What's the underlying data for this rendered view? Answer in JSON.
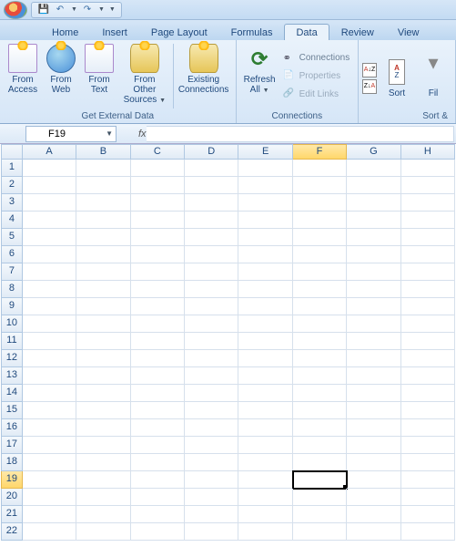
{
  "qat": {
    "save": "💾",
    "undo": "↶",
    "redo": "↷"
  },
  "tabs": [
    "Home",
    "Insert",
    "Page Layout",
    "Formulas",
    "Data",
    "Review",
    "View"
  ],
  "activeTab": 4,
  "ribbon": {
    "group1": {
      "label": "Get External Data",
      "btns": [
        {
          "l1": "From",
          "l2": "Access"
        },
        {
          "l1": "From",
          "l2": "Web"
        },
        {
          "l1": "From",
          "l2": "Text"
        },
        {
          "l1": "From Other",
          "l2": "Sources",
          "dd": true
        }
      ],
      "btn5": {
        "l1": "Existing",
        "l2": "Connections"
      }
    },
    "group2": {
      "label": "Connections",
      "refresh": {
        "l1": "Refresh",
        "l2": "All",
        "dd": true
      },
      "items": [
        "Connections",
        "Properties",
        "Edit Links"
      ]
    },
    "group3": {
      "label": "Sort &",
      "sortAZ": "A→Z",
      "sortZA": "Z→A",
      "sort": "Sort",
      "fil": "Fil"
    }
  },
  "nameBox": "F19",
  "fx": "fx",
  "cols": [
    "A",
    "B",
    "C",
    "D",
    "E",
    "F",
    "G",
    "H"
  ],
  "selColIndex": 5,
  "rows": [
    1,
    2,
    3,
    4,
    5,
    6,
    7,
    8,
    9,
    10,
    11,
    12,
    13,
    14,
    15,
    16,
    17,
    18,
    19,
    20,
    21,
    22
  ],
  "selRowIndex": 18,
  "activeCell": {
    "row": 18,
    "col": 5
  }
}
